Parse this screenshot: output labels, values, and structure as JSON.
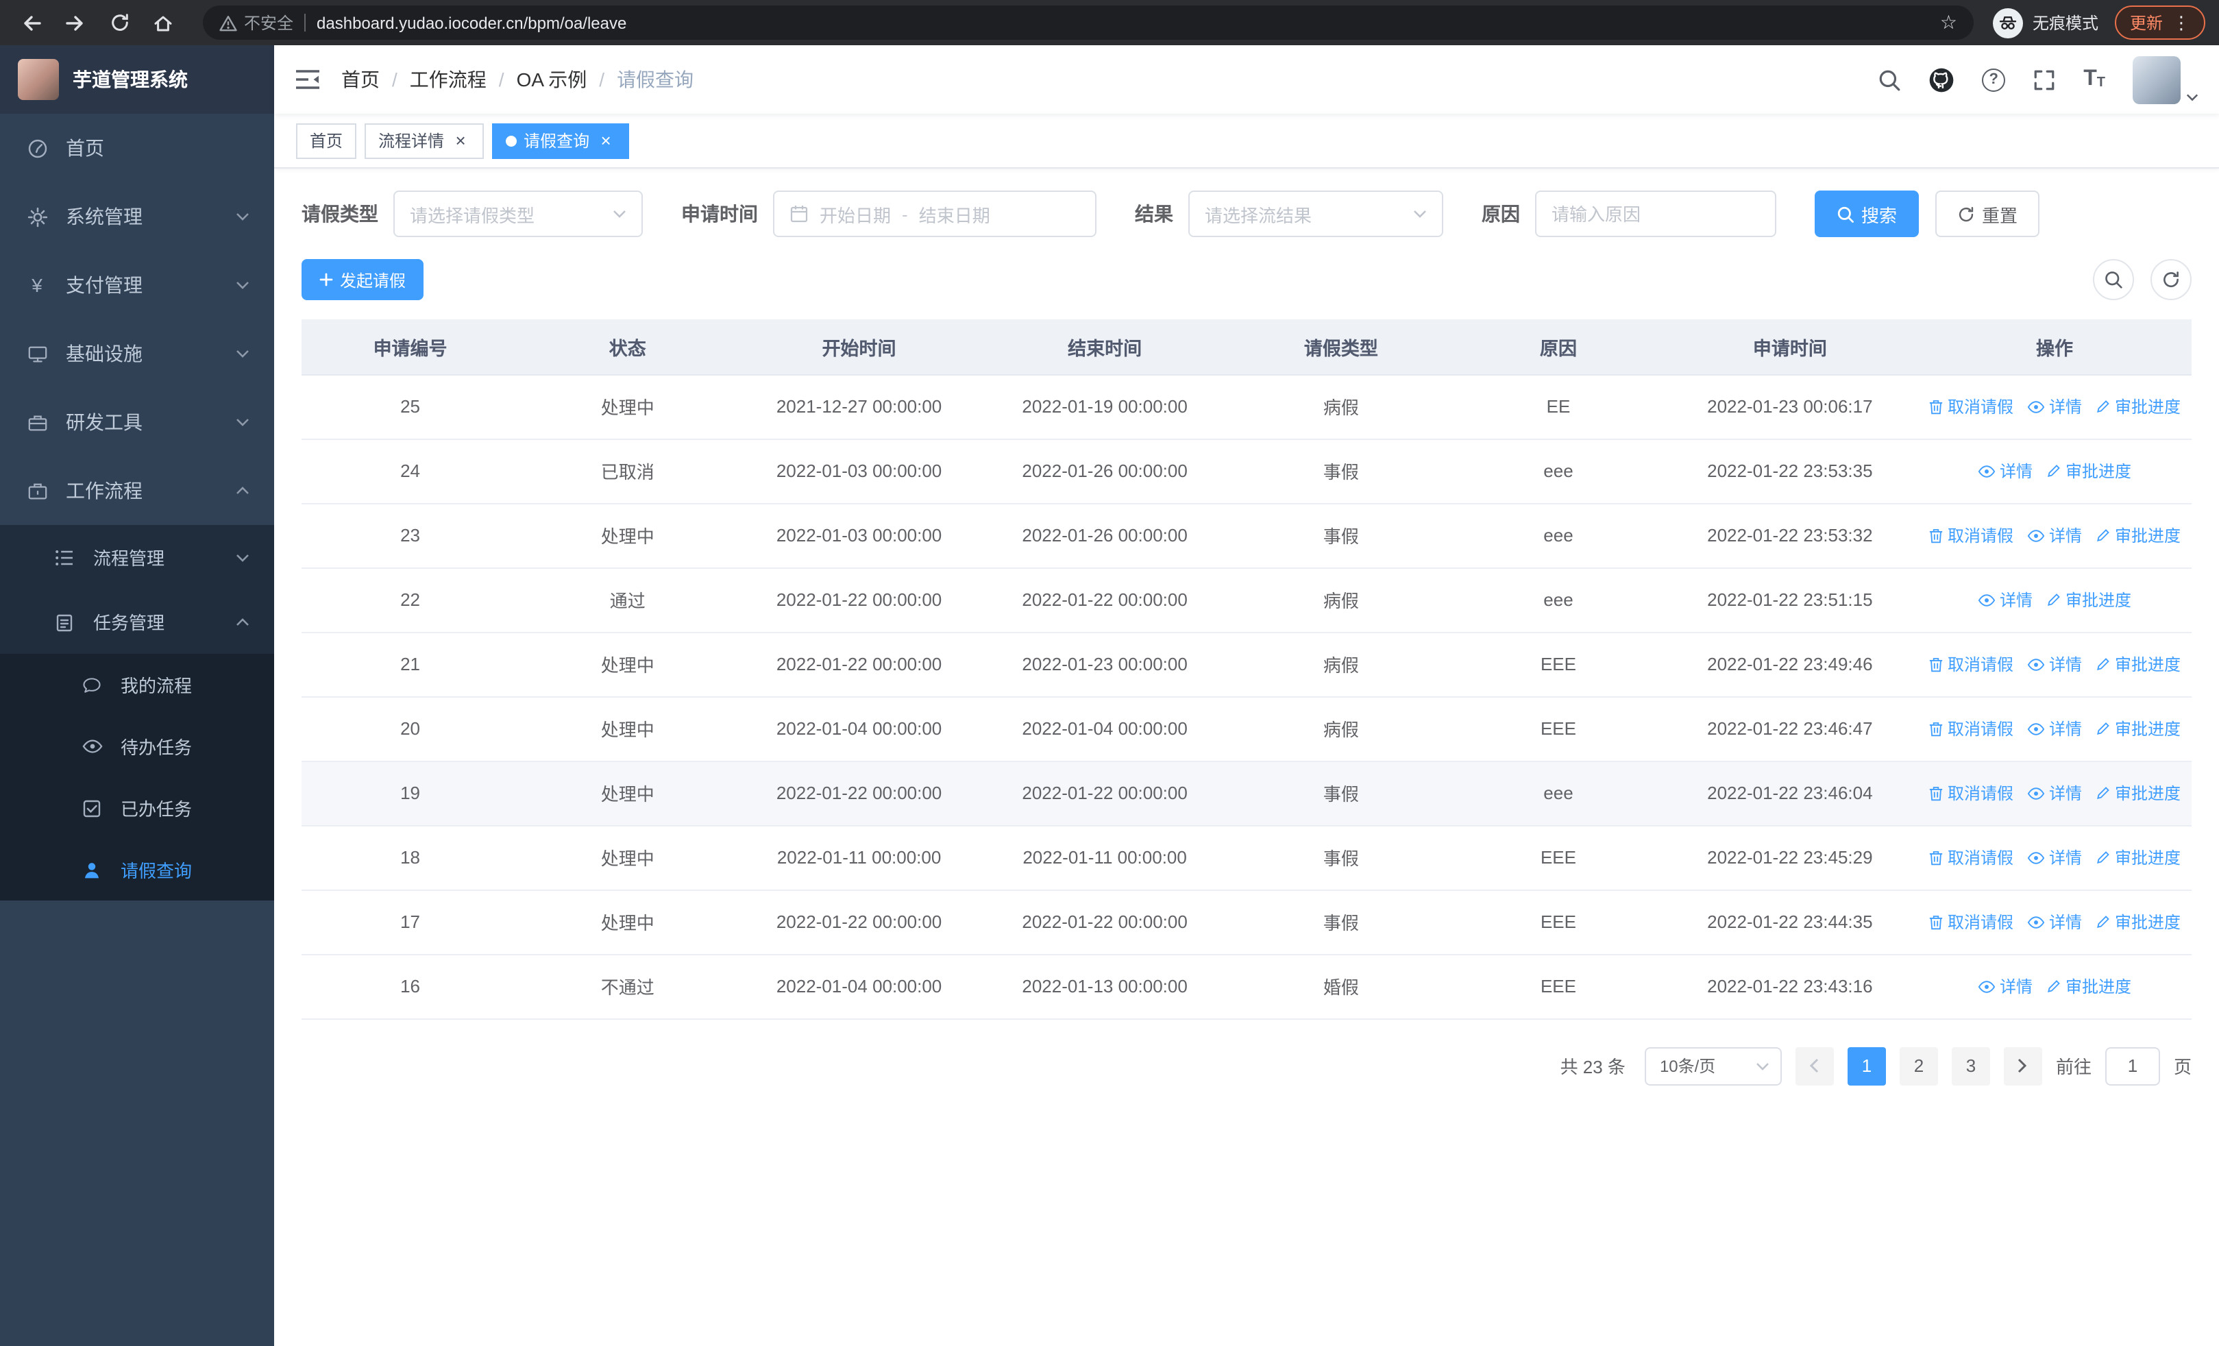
{
  "browser": {
    "security_label": "不安全",
    "url": "dashboard.yudao.iocoder.cn/bpm/oa/leave",
    "incognito_label": "无痕模式",
    "update_label": "更新"
  },
  "icons": {
    "star": "☆",
    "kebab": "⋮",
    "yen": "¥",
    "question": "?",
    "size_big": "T",
    "size_small": "T",
    "close": "×"
  },
  "sidebar": {
    "app_title": "芋道管理系统",
    "items": [
      {
        "label": "首页"
      },
      {
        "label": "系统管理"
      },
      {
        "label": "支付管理"
      },
      {
        "label": "基础设施"
      },
      {
        "label": "研发工具"
      },
      {
        "label": "工作流程"
      }
    ],
    "workflow_children": [
      {
        "label": "流程管理"
      },
      {
        "label": "任务管理"
      }
    ],
    "task_children": [
      {
        "label": "我的流程"
      },
      {
        "label": "待办任务"
      },
      {
        "label": "已办任务"
      },
      {
        "label": "请假查询"
      }
    ]
  },
  "header": {
    "breadcrumb": [
      "首页",
      "工作流程",
      "OA 示例",
      "请假查询"
    ]
  },
  "tabs": [
    {
      "label": "首页"
    },
    {
      "label": "流程详情"
    },
    {
      "label": "请假查询"
    }
  ],
  "filters": {
    "leave_type_label": "请假类型",
    "leave_type_placeholder": "请选择请假类型",
    "apply_time_label": "申请时间",
    "start_date_placeholder": "开始日期",
    "date_separator": "-",
    "end_date_placeholder": "结束日期",
    "result_label": "结果",
    "result_placeholder": "请选择流结果",
    "reason_label": "原因",
    "reason_placeholder": "请输入原因",
    "search_button": "搜索",
    "reset_button": "重置"
  },
  "toolbar": {
    "create_button": "发起请假"
  },
  "table": {
    "columns": [
      "申请编号",
      "状态",
      "开始时间",
      "结束时间",
      "请假类型",
      "原因",
      "申请时间",
      "操作"
    ],
    "actions": {
      "cancel": "取消请假",
      "detail": "详情",
      "progress": "审批进度"
    },
    "rows": [
      {
        "id": "25",
        "status": "处理中",
        "start": "2021-12-27 00:00:00",
        "end": "2022-01-19 00:00:00",
        "type": "病假",
        "reason": "EE",
        "applied": "2022-01-23 00:06:17",
        "cancellable": true,
        "highlight": false
      },
      {
        "id": "24",
        "status": "已取消",
        "start": "2022-01-03 00:00:00",
        "end": "2022-01-26 00:00:00",
        "type": "事假",
        "reason": "eee",
        "applied": "2022-01-22 23:53:35",
        "cancellable": false,
        "highlight": false
      },
      {
        "id": "23",
        "status": "处理中",
        "start": "2022-01-03 00:00:00",
        "end": "2022-01-26 00:00:00",
        "type": "事假",
        "reason": "eee",
        "applied": "2022-01-22 23:53:32",
        "cancellable": true,
        "highlight": false
      },
      {
        "id": "22",
        "status": "通过",
        "start": "2022-01-22 00:00:00",
        "end": "2022-01-22 00:00:00",
        "type": "病假",
        "reason": "eee",
        "applied": "2022-01-22 23:51:15",
        "cancellable": false,
        "highlight": false
      },
      {
        "id": "21",
        "status": "处理中",
        "start": "2022-01-22 00:00:00",
        "end": "2022-01-23 00:00:00",
        "type": "病假",
        "reason": "EEE",
        "applied": "2022-01-22 23:49:46",
        "cancellable": true,
        "highlight": false
      },
      {
        "id": "20",
        "status": "处理中",
        "start": "2022-01-04 00:00:00",
        "end": "2022-01-04 00:00:00",
        "type": "病假",
        "reason": "EEE",
        "applied": "2022-01-22 23:46:47",
        "cancellable": true,
        "highlight": false
      },
      {
        "id": "19",
        "status": "处理中",
        "start": "2022-01-22 00:00:00",
        "end": "2022-01-22 00:00:00",
        "type": "事假",
        "reason": "eee",
        "applied": "2022-01-22 23:46:04",
        "cancellable": true,
        "highlight": true
      },
      {
        "id": "18",
        "status": "处理中",
        "start": "2022-01-11 00:00:00",
        "end": "2022-01-11 00:00:00",
        "type": "事假",
        "reason": "EEE",
        "applied": "2022-01-22 23:45:29",
        "cancellable": true,
        "highlight": false
      },
      {
        "id": "17",
        "status": "处理中",
        "start": "2022-01-22 00:00:00",
        "end": "2022-01-22 00:00:00",
        "type": "事假",
        "reason": "EEE",
        "applied": "2022-01-22 23:44:35",
        "cancellable": true,
        "highlight": false
      },
      {
        "id": "16",
        "status": "不通过",
        "start": "2022-01-04 00:00:00",
        "end": "2022-01-13 00:00:00",
        "type": "婚假",
        "reason": "EEE",
        "applied": "2022-01-22 23:43:16",
        "cancellable": false,
        "highlight": false
      }
    ]
  },
  "pagination": {
    "total": "共 23 条",
    "page_size": "10条/页",
    "pages": [
      "1",
      "2",
      "3"
    ],
    "active_page": "1",
    "goto_label": "前往",
    "goto_value": "1",
    "goto_unit": "页"
  }
}
